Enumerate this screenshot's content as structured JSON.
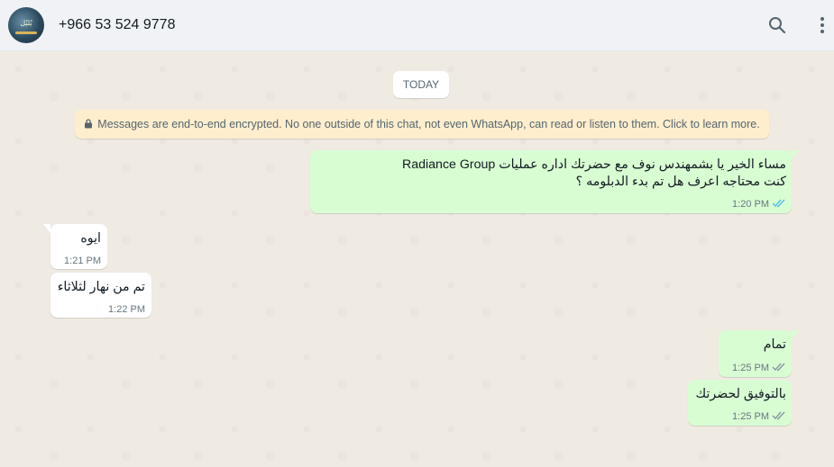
{
  "header": {
    "contact_name": "+966 53 524 9778",
    "avatar_text": "بُلبُل",
    "search_icon": "search-icon",
    "menu_icon": "menu-kebab-icon"
  },
  "chat": {
    "date_label": "TODAY",
    "encryption_notice": "Messages are end-to-end encrypted. No one outside of this chat, not even WhatsApp, can read or listen to them. Click to learn more.",
    "messages": [
      {
        "direction": "out",
        "lines": [
          "مساء الخير يا بشمهندس نوف مع حضرتك اداره عمليات Radiance Group",
          "كنت محتاجه اعرف هل تم بدء الدبلومه ؟"
        ],
        "time": "1:20 PM",
        "status": "read"
      },
      {
        "direction": "in",
        "lines": [
          "ايوه"
        ],
        "time": "1:21 PM"
      },
      {
        "direction": "in",
        "lines": [
          "تم من نهار لثلاثاء"
        ],
        "time": "1:22 PM"
      },
      {
        "direction": "out",
        "lines": [
          "تمام"
        ],
        "time": "1:25 PM",
        "status": "read"
      },
      {
        "direction": "out",
        "lines": [
          "بالتوفيق لحضرتك"
        ],
        "time": "1:25 PM",
        "status": "read"
      }
    ]
  },
  "colors": {
    "outgoing_bubble": "#d9fdd3",
    "incoming_bubble": "#ffffff",
    "read_ticks": "#53bdeb",
    "header_bg": "#f0f2f5",
    "chat_bg": "#efeae2",
    "notice_bg": "#ffeecd"
  }
}
